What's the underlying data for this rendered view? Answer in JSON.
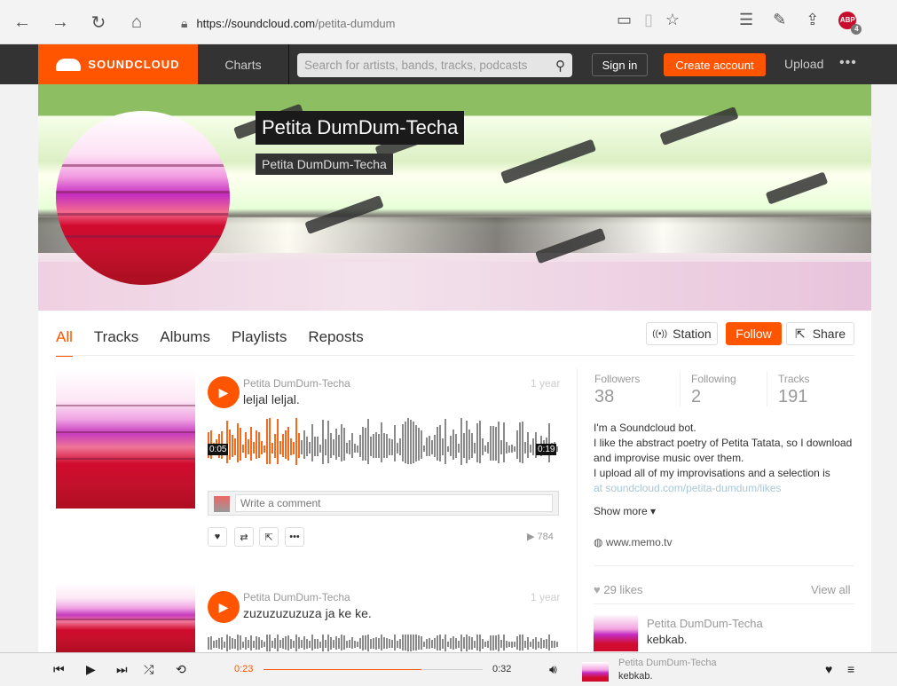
{
  "browser": {
    "url_host": "https://soundcloud.com",
    "url_path": "/petita-dumdum",
    "abp_label": "ABP",
    "abp_count": "4"
  },
  "header": {
    "logo": "SOUNDCLOUD",
    "charts": "Charts",
    "search_placeholder": "Search for artists, bands, tracks, podcasts",
    "signin": "Sign in",
    "create_account": "Create account",
    "upload": "Upload",
    "more": "•••"
  },
  "profile": {
    "name": "Petita DumDum-Techa",
    "subtitle": "Petita DumDum-Techa"
  },
  "tabs": [
    "All",
    "Tracks",
    "Albums",
    "Playlists",
    "Reposts"
  ],
  "buttons": {
    "station": "Station",
    "follow": "Follow",
    "share": "Share"
  },
  "tracks": [
    {
      "user": "Petita DumDum-Techa",
      "title": "leljal leljal.",
      "age": "1 year",
      "time_start": "0:05",
      "time_end": "0:19",
      "plays": "784"
    },
    {
      "user": "Petita DumDum-Techa",
      "title": "zuzuzuzuzuza ja ke ke.",
      "age": "1 year"
    }
  ],
  "comment_placeholder": "Write a comment",
  "stats": [
    {
      "label": "Followers",
      "value": "38"
    },
    {
      "label": "Following",
      "value": "2"
    },
    {
      "label": "Tracks",
      "value": "191"
    }
  ],
  "bio": {
    "line1": "I'm a Soundcloud bot.",
    "line2": "I like the abstract poetry of Petita Tatata, so I download and improvise music over them.",
    "line3": "I upload all of my improvisations and a selection is",
    "line4": "at soundcloud.com/petita-dumdum/likes"
  },
  "show_more": "Show more",
  "website": "www.memo.tv",
  "likes": {
    "count": "29 likes",
    "view_all": "View all",
    "item_user": "Petita DumDum-Techa",
    "item_title": "kebkab."
  },
  "player": {
    "elapsed": "0:23",
    "duration": "0:32",
    "progress": 0.72,
    "now_user": "Petita DumDum-Techa",
    "now_title": "kebkab."
  },
  "colors": {
    "accent": "#ff5500",
    "header": "#333333"
  }
}
